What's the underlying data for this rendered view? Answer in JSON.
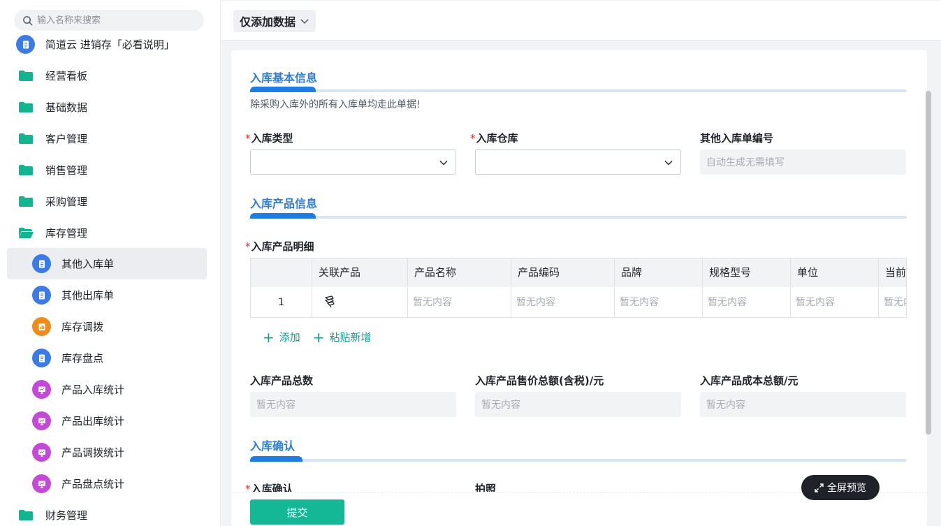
{
  "sidebar": {
    "search_placeholder": "输入名称来搜索",
    "items": [
      {
        "label": "简道云 进销存「必看说明」",
        "icon": "doc-icon"
      },
      {
        "label": "经营看板",
        "icon": "folder-icon"
      },
      {
        "label": "基础数据",
        "icon": "folder-icon"
      },
      {
        "label": "客户管理",
        "icon": "folder-icon"
      },
      {
        "label": "销售管理",
        "icon": "folder-icon"
      },
      {
        "label": "采购管理",
        "icon": "folder-icon"
      },
      {
        "label": "库存管理",
        "icon": "folder-open-icon"
      },
      {
        "label": "其他入库单",
        "icon": "doc-icon"
      },
      {
        "label": "其他出库单",
        "icon": "doc-icon"
      },
      {
        "label": "库存调拨",
        "icon": "report-icon"
      },
      {
        "label": "库存盘点",
        "icon": "doc-icon"
      },
      {
        "label": "产品入库统计",
        "icon": "chart-icon"
      },
      {
        "label": "产品出库统计",
        "icon": "chart-icon"
      },
      {
        "label": "产品调拨统计",
        "icon": "chart-icon"
      },
      {
        "label": "产品盘点统计",
        "icon": "chart-icon"
      },
      {
        "label": "财务管理",
        "icon": "folder-icon"
      }
    ]
  },
  "topbar": {
    "mode_label": "仅添加数据"
  },
  "form": {
    "section1": {
      "title": "入库基本信息",
      "desc": "除采购入库外的所有入库单均走此单据!"
    },
    "inbound_type_label": "入库类型",
    "warehouse_label": "入库仓库",
    "order_no_label": "其他入库单编号",
    "order_no_placeholder": "自动生成无需填写",
    "section2": {
      "title": "入库产品信息"
    },
    "detail_label": "入库产品明细",
    "table": {
      "headers": [
        "关联产品",
        "产品名称",
        "产品编码",
        "品牌",
        "规格型号",
        "单位",
        "当前"
      ],
      "row_number": "1",
      "empty": "暂无内容"
    },
    "add_label": "添加",
    "paste_label": "粘贴新增",
    "total_qty_label": "入库产品总数",
    "total_price_label": "入库产品售价总额(含税)/元",
    "total_cost_label": "入库产品成本总额/元",
    "empty_value": "暂无内容",
    "section3": {
      "title": "入库确认"
    },
    "confirm_label": "入库确认",
    "photo_label": "拍照",
    "submit_label": "提交"
  },
  "fullscreen_label": "全屏预览",
  "colors": {
    "accent": "#1a7de8",
    "submit": "#14b796",
    "folder": "#11b58f"
  }
}
